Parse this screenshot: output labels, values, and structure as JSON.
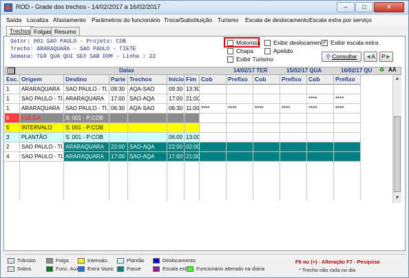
{
  "window": {
    "title": "ROD - Grade dos trechos  -  14/02/2017 a 16/02/2017",
    "min": "–",
    "max": "□",
    "close": "✕"
  },
  "menu": [
    "Saída",
    "Localiza",
    "Afastamento",
    "Parâmetros do funcionário",
    "Troca/Substituição",
    "Turismo",
    "Escala de deslocamento",
    "Escala extra por serviço"
  ],
  "tabs": [
    "Trechos",
    "Folgas",
    "Resumo"
  ],
  "info": {
    "setor": "Setor: 001 SAO PAULO - Projeto: COB",
    "trecho": "Trecho: ARARAQUARA - SAO PAULO - TIETE",
    "semana": "Semana: TER QUA QUI SEX SAB DOM  - Linha : 22"
  },
  "options": {
    "motorista": "Motorista",
    "chapa": "Chapa",
    "exibir_turismo": "Exibir Turismo",
    "exibir_deslocamento": "Exibir deslocamento",
    "apelido": "Apelido",
    "exibir_escala_extra": "Exibir escala extra"
  },
  "buttons": {
    "consultar": "Consultar",
    "prev": "◄",
    "a": "A",
    "p": "P",
    "next": "►"
  },
  "datas": {
    "label": "Datas",
    "d1": "14/02/17 TER",
    "d2": "15/02/17 QUA",
    "d3": "16/02/17 QU"
  },
  "columns": [
    "Esc.",
    "Origem",
    "Destino",
    "Parte",
    "Trechos",
    "Início",
    "Fim",
    "Cob",
    "Prefixo",
    "Cob",
    "Prefixo",
    "Cob",
    "Prefixo"
  ],
  "rows": [
    {
      "esc": "1",
      "origem": "ARARAQUARA",
      "destino": "SAO PAULO - TI...",
      "parte": "09:30",
      "trechos": "AQA-SAO",
      "inicio": "09:30",
      "fim": "13:30",
      "c1": "",
      "p1": "",
      "c2": "",
      "p2": "",
      "c3": "",
      "p3": "",
      "style": "white"
    },
    {
      "esc": "1",
      "origem": "SAO PAULO - TI...",
      "destino": "ARARAQUARA",
      "parte": "17:00",
      "trechos": "SAO-AQA",
      "inicio": "17:00",
      "fim": "21:00",
      "c1": "",
      "p1": "",
      "c2": "",
      "p2": "",
      "c3": "****",
      "p3": "****",
      "style": "white"
    },
    {
      "esc": "1",
      "origem": "ARARAQUARA",
      "destino": "SAO PAULO - TI...",
      "parte": "06:30",
      "trechos": "AQA-SAO",
      "inicio": "06:30",
      "fim": "11:00",
      "c1": "****",
      "p1": "****",
      "c2": "****",
      "p2": "****",
      "c3": "****",
      "p3": "****",
      "style": "white"
    },
    {
      "esc": "6",
      "origem": "FOLGA",
      "destino": "S: 001 - P:COB",
      "parte": "",
      "trechos": "",
      "inicio": "",
      "fim": "",
      "c1": "",
      "p1": "",
      "c2": "",
      "p2": "",
      "c3": "",
      "p3": "",
      "style": "folga"
    },
    {
      "esc": "5",
      "origem": "INTERVALO",
      "destino": "S: 001 - P:COB",
      "parte": "",
      "trechos": "",
      "inicio": "",
      "fim": "",
      "c1": "",
      "p1": "",
      "c2": "",
      "p2": "",
      "c3": "",
      "p3": "",
      "style": "intervalo"
    },
    {
      "esc": "3",
      "origem": "PLANTÃO",
      "destino": "S: 001 - P:COB",
      "parte": "",
      "trechos": "",
      "inicio": "06:00",
      "fim": "13:00",
      "c1": "",
      "p1": "",
      "c2": "",
      "p2": "",
      "c3": "",
      "p3": "",
      "style": "plantao"
    },
    {
      "esc": "2",
      "origem": "SAO PAULO - TI...",
      "destino": "ARARAQUARA",
      "parte": "22:00",
      "trechos": "SAO-AQA",
      "inicio": "22:00",
      "fim": "02:00",
      "c1": "",
      "p1": "",
      "c2": "",
      "p2": "",
      "c3": "",
      "p3": "",
      "style": "passe"
    },
    {
      "esc": "4",
      "origem": "SAO PAULO - TI...",
      "destino": "ARARAQUARA",
      "parte": "17:00",
      "trechos": "SAO-AQA",
      "inicio": "17:00",
      "fim": "21:00",
      "c1": "",
      "p1": "",
      "c2": "",
      "p2": "",
      "c3": "",
      "p3": "",
      "style": "passe"
    }
  ],
  "legend": [
    {
      "label": "Trânsito",
      "color": "#cfe6f7"
    },
    {
      "label": "Folga",
      "color": "#8c8c8c"
    },
    {
      "label": "Intervalo",
      "color": "#ffff00"
    },
    {
      "label": "Plantão",
      "color": "#ccffff"
    },
    {
      "label": "Deslocamento",
      "color": "#0a00d8"
    },
    {
      "label": "Sobra",
      "color": "#c9e8c9"
    },
    {
      "label": "Func. Aux",
      "color": "#007a2e"
    },
    {
      "label": "Extra Vazio",
      "color": "#1f6fd8"
    },
    {
      "label": "Passe",
      "color": "#008080"
    },
    {
      "label": "Escala extra",
      "color": "#8c1c9a"
    },
    {
      "label": "Funcionário alterado na diária",
      "color": "#42ff2c"
    }
  ],
  "footer": {
    "hint": "F6 ou (+) - Alteração  F7 - Pesquisa",
    "note": "* Trecho não roda no dia"
  },
  "colors": {
    "header_text": "#1d3b8a",
    "info_text": "#1c2f78",
    "hint_red": "#b00000"
  }
}
